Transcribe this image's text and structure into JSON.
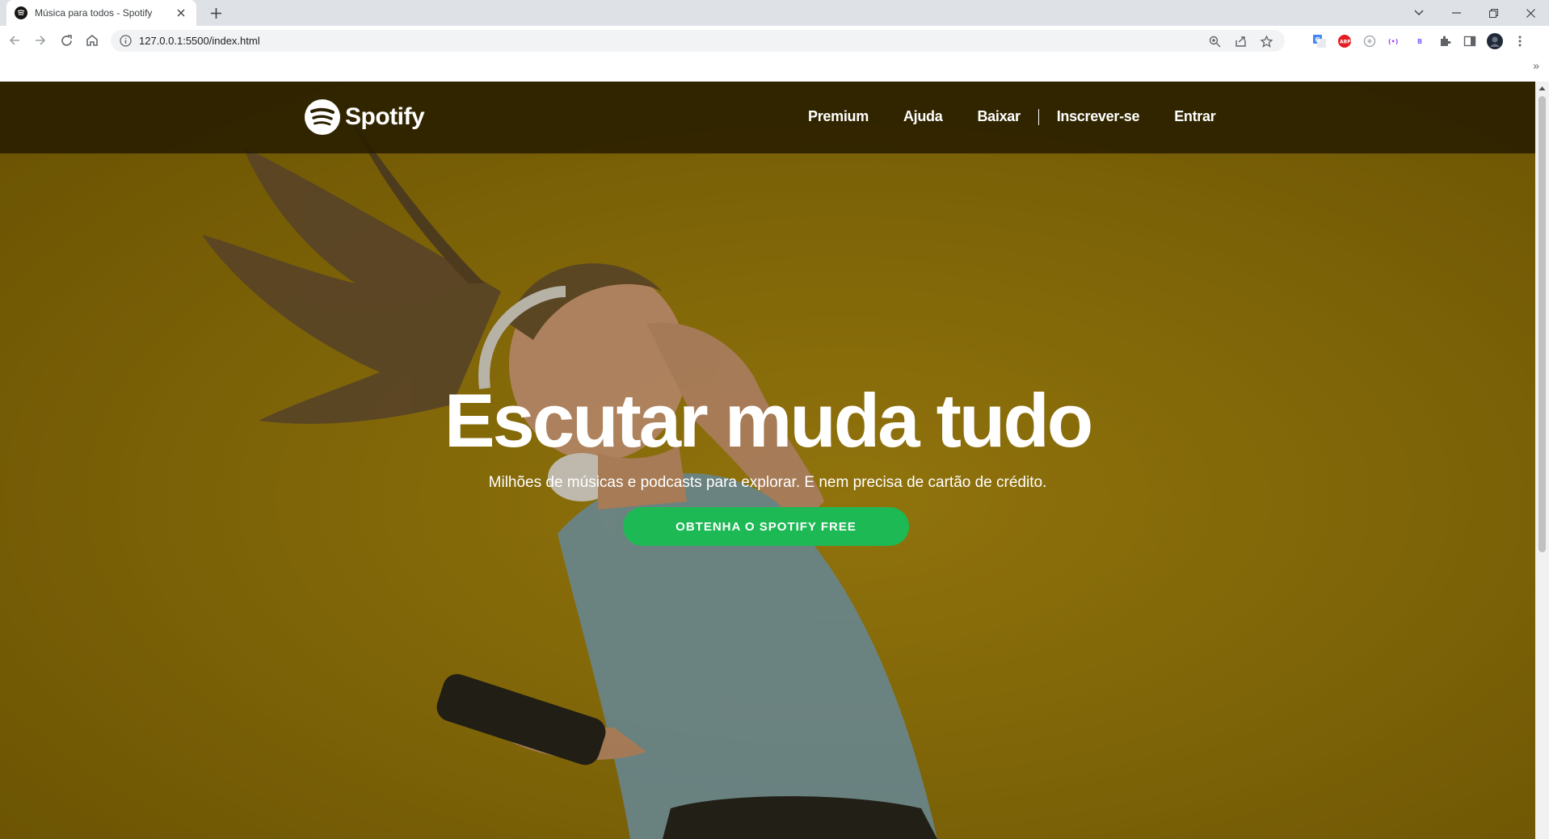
{
  "browser": {
    "tab_title": "Música para todos - Spotify",
    "url": "127.0.0.1:5500/index.html",
    "bookmarks_more": "»"
  },
  "site": {
    "brand": "Spotify",
    "nav": {
      "premium": "Premium",
      "ajuda": "Ajuda",
      "baixar": "Baixar",
      "inscrever": "Inscrever-se",
      "entrar": "Entrar"
    }
  },
  "hero": {
    "title": "Escutar muda tudo",
    "subtitle": "Milhões de músicas e podcasts para explorar. E nem precisa de cartão de crédito.",
    "cta": "OBTENHA O SPOTIFY FREE"
  },
  "colors": {
    "spotify_green": "#1db954",
    "hero_yellow": "#b18d10"
  },
  "icons": [
    "spotify-icon",
    "close-icon",
    "plus-icon",
    "back-icon",
    "forward-icon",
    "reload-icon",
    "home-icon",
    "info-icon",
    "zoom-icon",
    "share-icon",
    "star-icon",
    "puzzle-icon",
    "sidepanel-icon",
    "kebab-icon"
  ]
}
